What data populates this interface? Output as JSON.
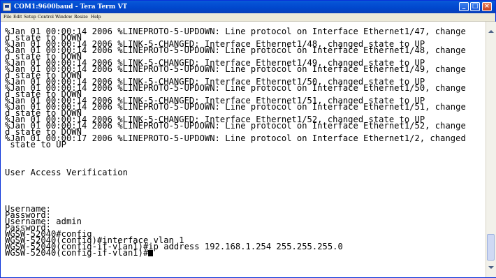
{
  "window": {
    "title": "COM1:9600baud - Tera Term VT",
    "buttons": {
      "minimize": "_",
      "maximize": "□",
      "close": "×"
    }
  },
  "menubar": {
    "items": [
      "File",
      "Edit",
      "Setup",
      "Control",
      "Window",
      "Resize",
      "Help"
    ]
  },
  "terminal": {
    "lines": [
      "%Jan 01 00:00:14 2006 %LINEPROTO-5-UPDOWN: Line protocol on Interface Ethernet1/47, change",
      "d state to DOWN",
      "%Jan 01 00:00:14 2006 %LINK-5-CHANGED: Interface Ethernet1/48, changed state to UP",
      "%Jan 01 00:00:14 2006 %LINEPROTO-5-UPDOWN: Line protocol on Interface Ethernet1/48, change",
      "d state to DOWN",
      "%Jan 01 00:00:14 2006 %LINK-5-CHANGED: Interface Ethernet1/49, changed state to UP",
      "%Jan 01 00:00:14 2006 %LINEPROTO-5-UPDOWN: Line protocol on Interface Ethernet1/49, change",
      "d state to DOWN",
      "%Jan 01 00:00:14 2006 %LINK-5-CHANGED: Interface Ethernet1/50, changed state to UP",
      "%Jan 01 00:00:14 2006 %LINEPROTO-5-UPDOWN: Line protocol on Interface Ethernet1/50, change",
      "d state to DOWN",
      "%Jan 01 00:00:14 2006 %LINK-5-CHANGED: Interface Ethernet1/51, changed state to UP",
      "%Jan 01 00:00:14 2006 %LINEPROTO-5-UPDOWN: Line protocol on Interface Ethernet1/51, change",
      "d state to DOWN",
      "%Jan 01 00:00:14 2006 %LINK-5-CHANGED: Interface Ethernet1/52, changed state to UP",
      "%Jan 01 00:00:14 2006 %LINEPROTO-5-UPDOWN: Line protocol on Interface Ethernet1/52, change",
      "d state to DOWN",
      "%Jan 01 00:00:17 2006 %LINEPROTO-5-UPDOWN: Line protocol on Interface Ethernet1/2, changed",
      " state to UP",
      "",
      "User Access Verification",
      "",
      "Username:",
      "Password:",
      "Username: admin",
      "Password:",
      "WGSW-52040#config",
      "WGSW-52040(config)#interface vlan 1",
      "WGSW-52040(config-if-vlan1)#ip address 192.168.1.254 255.255.255.0",
      "WGSW-52040(config-if-vlan1)#"
    ]
  },
  "colors": {
    "titlebar": "#0047cc",
    "terminal_bg": "#ffffff",
    "terminal_fg": "#000000"
  }
}
